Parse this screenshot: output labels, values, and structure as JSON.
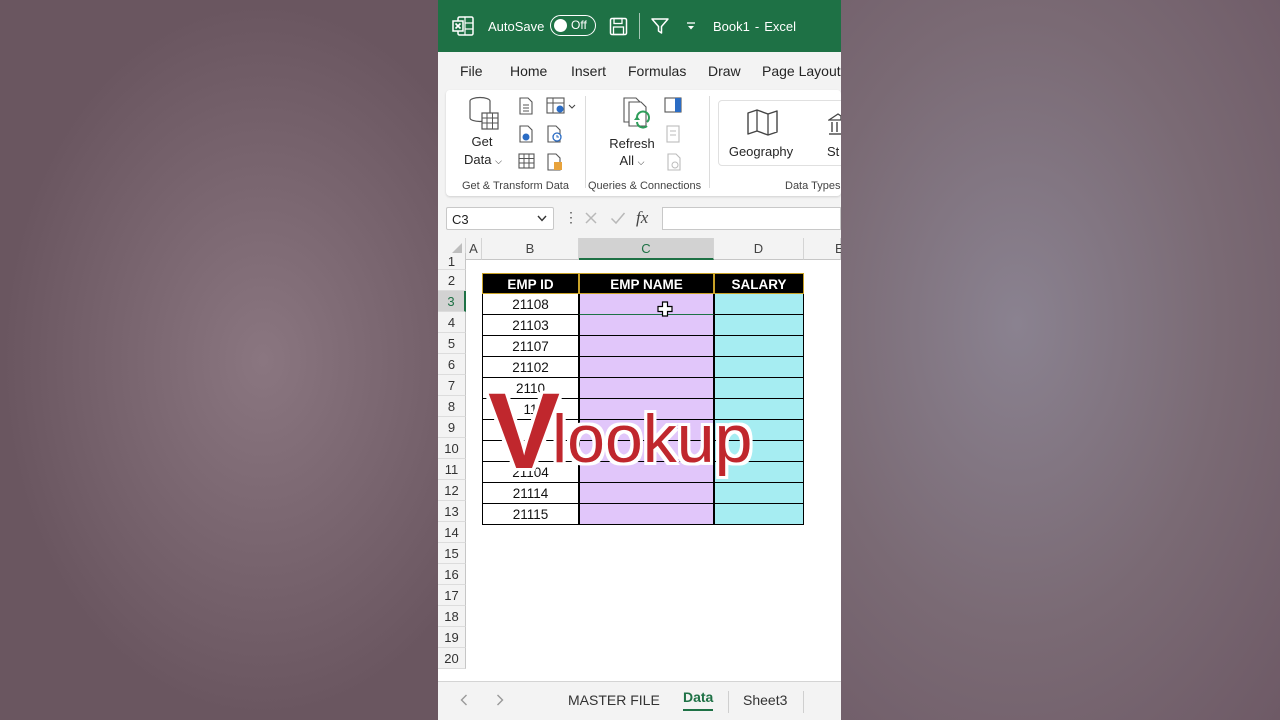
{
  "titlebar": {
    "autosave_label": "AutoSave",
    "toggle_state": "Off",
    "filename": "Book1",
    "separator": "-",
    "app": "Excel"
  },
  "menu": [
    "File",
    "Home",
    "Insert",
    "Formulas",
    "Draw",
    "Page Layout"
  ],
  "ribbon": {
    "get_data": "Get",
    "get_data_2": "Data",
    "refresh": "Refresh",
    "refresh_2": "All",
    "geography": "Geography",
    "stocks_partial": "St",
    "group_1": "Get & Transform Data",
    "group_2": "Queries & Connections",
    "group_3": "Data Types"
  },
  "formula_bar": {
    "name_box": "C3",
    "fx": "fx",
    "content": ""
  },
  "columns": [
    "A",
    "B",
    "C",
    "D",
    "E"
  ],
  "rows": [
    "1",
    "2",
    "3",
    "4",
    "5",
    "6",
    "7",
    "8",
    "9",
    "10",
    "11",
    "12",
    "13",
    "14",
    "15",
    "16",
    "17",
    "18",
    "19",
    "20"
  ],
  "table": {
    "headers": [
      "EMP ID",
      "EMP NAME",
      "SALARY"
    ],
    "emp_ids": [
      "21108",
      "21103",
      "21107",
      "21102",
      "2110",
      "11",
      "",
      "",
      "21104",
      "21114",
      "21115"
    ]
  },
  "overlay_title": {
    "big_letter": "V",
    "rest": "lookup"
  },
  "sheet_tabs": [
    "MASTER FILE",
    "Data",
    "Sheet3"
  ],
  "active_sheet": "Data",
  "colors": {
    "excel_green": "#1e7145",
    "header_black": "#000000",
    "name_col_fill": "#e1c6fa",
    "salary_col_fill": "#a6edf2",
    "title_red": "#c0272d"
  }
}
